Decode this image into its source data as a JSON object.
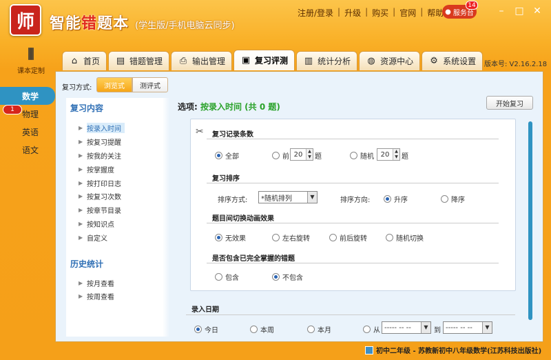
{
  "app": {
    "logo_text": "师",
    "title_part1": "智能",
    "title_red": "错",
    "title_part2": "题本",
    "subtitle": "(学生版/手机电脑云同步)",
    "top_links": [
      "注册/登录",
      "升级",
      "购买",
      "官网",
      "帮助"
    ],
    "service_label": "服务台",
    "service_badge": "14",
    "version": "版本号: V2.16.2.18"
  },
  "book": {
    "label": "课本定制"
  },
  "tabs": [
    {
      "label": "首页",
      "icon": "home-icon"
    },
    {
      "label": "错题管理",
      "icon": "clipboard-icon"
    },
    {
      "label": "输出管理",
      "icon": "printer-icon"
    },
    {
      "label": "复习评测",
      "icon": "review-icon",
      "active": true
    },
    {
      "label": "统计分析",
      "icon": "chart-icon"
    },
    {
      "label": "资源中心",
      "icon": "resource-icon"
    },
    {
      "label": "系统设置",
      "icon": "gear-icon"
    }
  ],
  "subjects": [
    "数学",
    "物理",
    "英语",
    "语文"
  ],
  "subject_badge": "1",
  "mode": {
    "label": "复习方式:",
    "option_on": "浏览式",
    "option_off": "测评式"
  },
  "leftnav": {
    "review_heading": "复习内容",
    "review_items": [
      "按录入时间",
      "按复习提醒",
      "按我的关注",
      "按掌握度",
      "按打印日志",
      "按复习次数",
      "按章节目录",
      "按知识点",
      "自定义"
    ],
    "history_heading": "历史统计",
    "history_items": [
      "按月查看",
      "按周查看"
    ]
  },
  "selection": {
    "prefix": "选项:",
    "value": "按录入时间 (共 0 题)"
  },
  "start_button": "开始复习",
  "card": {
    "count_title": "复习记录条数",
    "count_all": "全部",
    "count_first": "前",
    "count_first_value": "20",
    "count_random": "随机",
    "count_random_value": "20",
    "count_unit": "题",
    "sort_title": "复习排序",
    "sort_way_label": "排序方式:",
    "sort_way_value": "*随机排列",
    "sort_dir_label": "排序方向:",
    "sort_asc": "升序",
    "sort_desc": "降序",
    "anim_title": "题目间切换动画效果",
    "anim_options": [
      "无效果",
      "左右旋转",
      "前后旋转",
      "随机切换"
    ],
    "include_title": "是否包含已完全掌握的错题",
    "include_yes": "包含",
    "include_no": "不包含"
  },
  "date": {
    "title": "录入日期",
    "options": [
      "今日",
      "本周",
      "本月"
    ],
    "from_label": "从",
    "from_value": "----- -- --",
    "to_label": "到",
    "to_value": "----- -- --"
  },
  "status": {
    "text": "初中二年级 - 苏教新初中八年级数学(江苏科技出版社)"
  }
}
